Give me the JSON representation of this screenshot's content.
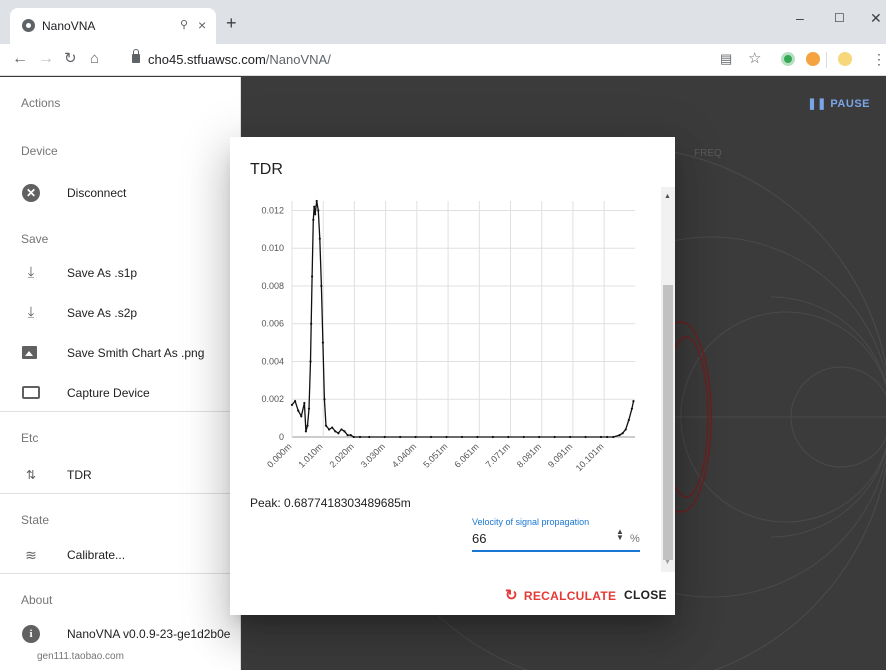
{
  "browser": {
    "tab_title": "NanoVNA",
    "audio_icon": "pin-icon",
    "close_glyph": "×",
    "new_tab_glyph": "+",
    "url_host": "cho45.stfuawsc.com",
    "url_path": "/NanoVNA/",
    "window": {
      "minimize": "–",
      "maximize": "☐",
      "close": "✕"
    }
  },
  "sidebar": {
    "sections": {
      "actions": "Actions",
      "device": "Device",
      "save": "Save",
      "etc": "Etc",
      "state": "State",
      "about": "About"
    },
    "items": {
      "disconnect": "Disconnect",
      "save_s1p": "Save As .s1p",
      "save_s2p": "Save As .s2p",
      "save_png": "Save Smith Chart As .png",
      "capture": "Capture Device",
      "tdr": "TDR",
      "calibrate": "Calibrate...",
      "version": "NanoVNA v0.0.9-23-ge1d2b0e"
    },
    "footer_note": "gen111.taobao.com"
  },
  "main": {
    "pause_label": "PAUSE",
    "freq_label": "FREQ"
  },
  "dialog": {
    "title": "TDR",
    "peak_text": "Peak: 0.6877418303489685m",
    "velocity_label": "Velocity of signal propagation",
    "velocity_value": "66",
    "velocity_unit": "%",
    "recalculate_label": "RECALCULATE",
    "close_label": "CLOSE"
  },
  "colors": {
    "accent": "#1976d2",
    "recalc": "#e53935",
    "pause": "#7aa6e8"
  },
  "chart_data": {
    "type": "scatter",
    "xlabel": "",
    "ylabel": "",
    "xlim": [
      0,
      11.1
    ],
    "ylim": [
      0,
      0.0125
    ],
    "x_ticks": [
      "0.000m",
      "1.010m",
      "2.020m",
      "3.030m",
      "4.040m",
      "5.051m",
      "6.061m",
      "7.071m",
      "8.081m",
      "9.091m",
      "10.101m"
    ],
    "y_ticks": [
      "0.012",
      "0.010",
      "0.008",
      "0.006",
      "0.004",
      "0.002",
      "0"
    ],
    "x": [
      0.0,
      0.1,
      0.2,
      0.3,
      0.4,
      0.45,
      0.5,
      0.55,
      0.6,
      0.62,
      0.65,
      0.69,
      0.72,
      0.75,
      0.8,
      0.85,
      0.9,
      0.95,
      1.0,
      1.05,
      1.1,
      1.2,
      1.3,
      1.4,
      1.5,
      1.6,
      1.7,
      1.8,
      1.9,
      2.0,
      2.2,
      2.5,
      3.0,
      3.5,
      4.0,
      4.5,
      5.0,
      5.5,
      6.0,
      6.5,
      7.0,
      7.5,
      8.0,
      8.5,
      9.0,
      9.5,
      10.0,
      10.2,
      10.4,
      10.6,
      10.7,
      10.8,
      10.9,
      11.0,
      11.05
    ],
    "y": [
      0.0017,
      0.0019,
      0.0014,
      0.0011,
      0.0018,
      0.0003,
      0.0006,
      0.0015,
      0.004,
      0.006,
      0.0085,
      0.0115,
      0.0122,
      0.0118,
      0.0125,
      0.012,
      0.0105,
      0.008,
      0.005,
      0.002,
      0.0006,
      0.0004,
      0.0005,
      0.0003,
      0.0002,
      0.0004,
      0.0003,
      0.0001,
      0.0001,
      0.0,
      0.0,
      0.0,
      0.0,
      0.0,
      0.0,
      0.0,
      0.0,
      0.0,
      0.0,
      0.0,
      0.0,
      0.0,
      0.0,
      0.0,
      0.0,
      0.0,
      0.0,
      0.0,
      0.0,
      0.0001,
      0.0002,
      0.0004,
      0.0009,
      0.0015,
      0.0019
    ],
    "grid": true,
    "legend": "none"
  }
}
